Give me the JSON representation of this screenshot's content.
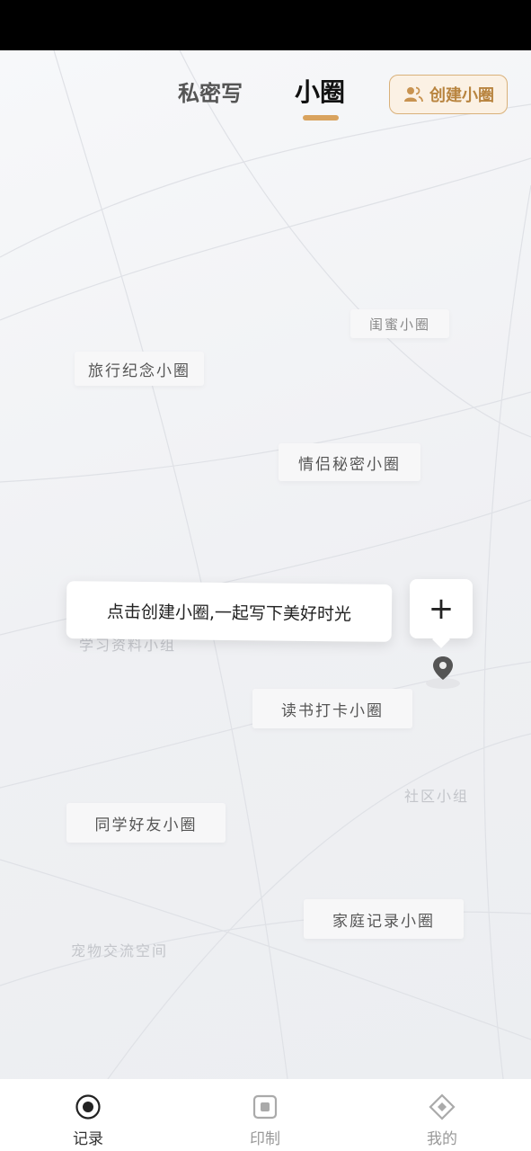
{
  "header": {
    "tab_private": "私密写",
    "tab_circle": "小圈",
    "create_button": "创建小圈"
  },
  "circles": [
    "闺蜜小圈",
    "旅行纪念小圈",
    "情侣秘密小圈",
    "读书打卡小圈",
    "同学好友小圈",
    "家庭记录小圈"
  ],
  "faded_circles": [
    "学习资料小组",
    "社区小组",
    "宠物交流空间"
  ],
  "tooltip": "点击创建小圈,一起写下美好时光",
  "plus_symbol": "+",
  "bottom_nav": {
    "record": "记录",
    "print": "印制",
    "mine": "我的"
  },
  "colors": {
    "accent": "#d9a35e",
    "accent_text": "#b8843f"
  }
}
